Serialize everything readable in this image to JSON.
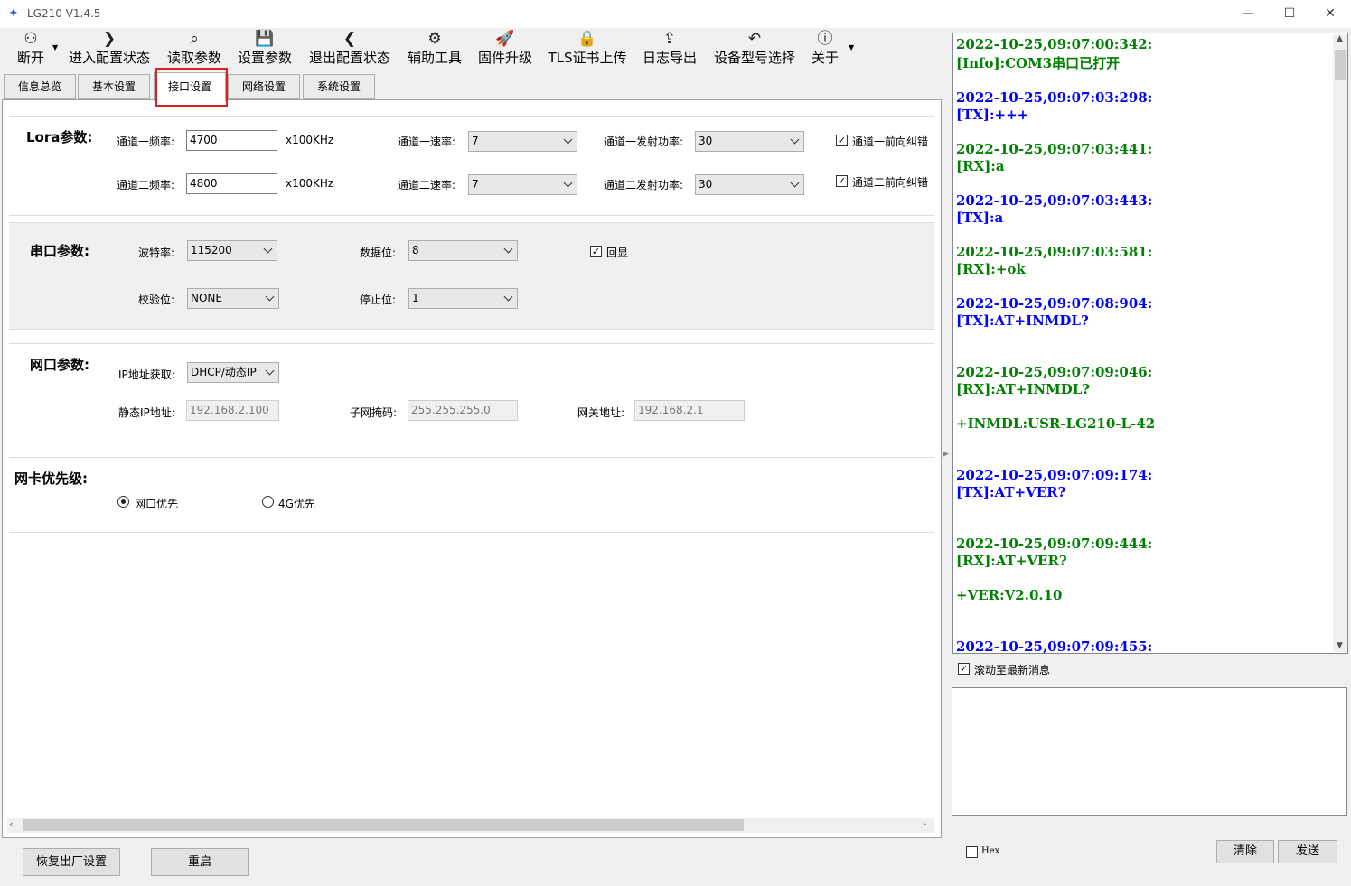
{
  "app": {
    "title": "LG210 V1.4.5"
  },
  "window": {
    "minimize": "—",
    "maximize": "☐",
    "close": "✕"
  },
  "toolbar": {
    "items": [
      {
        "icon": "⚇",
        "label": "断开"
      },
      {
        "icon": "❯",
        "label": "进入配置状态"
      },
      {
        "icon": "⌕",
        "label": "读取参数"
      },
      {
        "icon": "💾",
        "label": "设置参数"
      },
      {
        "icon": "❮",
        "label": "退出配置状态"
      },
      {
        "icon": "⚙",
        "label": "辅助工具"
      },
      {
        "icon": "🚀",
        "label": "固件升级"
      },
      {
        "icon": "🔒",
        "label": "TLS证书上传"
      },
      {
        "icon": "⇪",
        "label": "日志导出"
      },
      {
        "icon": "↶",
        "label": "设备型号选择"
      },
      {
        "icon": "ⓘ",
        "label": "关于"
      }
    ]
  },
  "tabs": [
    "信息总览",
    "基本设置",
    "接口设置",
    "网络设置",
    "系统设置"
  ],
  "active_tab": "接口设置",
  "lora": {
    "title": "Lora参数:",
    "ch1_freq_label": "通道一频率:",
    "ch1_freq": "4700",
    "unit": "x100KHz",
    "ch2_freq_label": "通道二频率:",
    "ch2_freq": "4800",
    "ch1_rate_label": "通道一速率:",
    "ch1_rate": "7",
    "ch2_rate_label": "通道二速率:",
    "ch2_rate": "7",
    "ch1_power_label": "通道一发射功率:",
    "ch1_power": "30",
    "ch2_power_label": "通道二发射功率:",
    "ch2_power": "30",
    "ch1_fec_label": "通道一前向纠错",
    "ch1_fec": true,
    "ch2_fec_label": "通道二前向纠错",
    "ch2_fec": true
  },
  "serial": {
    "title": "串口参数:",
    "baud_label": "波特率:",
    "baud": "115200",
    "data_bits_label": "数据位:",
    "data_bits": "8",
    "echo_label": "回显",
    "echo": true,
    "parity_label": "校验位:",
    "parity": "NONE",
    "stop_bits_label": "停止位:",
    "stop_bits": "1"
  },
  "net": {
    "title": "网口参数:",
    "ip_mode_label": "IP地址获取:",
    "ip_mode": "DHCP/动态IP",
    "static_ip_label": "静态IP地址:",
    "static_ip": "192.168.2.100",
    "mask_label": "子网掩码:",
    "mask": "255.255.255.0",
    "gateway_label": "网关地址:",
    "gateway": "192.168.2.1"
  },
  "nic": {
    "title": "网卡优先级:",
    "option_eth": "网口优先",
    "option_4g": "4G优先",
    "selected": "网口优先"
  },
  "buttons": {
    "factory_reset": "恢复出厂设置",
    "restart": "重启",
    "clear": "清除",
    "send": "发送"
  },
  "log": {
    "lines": [
      {
        "text": "2022-10-25,09:07:00:342:",
        "color": "#008000"
      },
      {
        "text": "[Info]:COM3串口已打开",
        "color": "#008000"
      },
      {
        "text": "2022-10-25,09:07:03:298:",
        "color": "#0000ff"
      },
      {
        "text": "[TX]:+++",
        "color": "#0000ff"
      },
      {
        "text": "2022-10-25,09:07:03:441:",
        "color": "#008000"
      },
      {
        "text": "[RX]:a",
        "color": "#008000"
      },
      {
        "text": "2022-10-25,09:07:03:443:",
        "color": "#0000ff"
      },
      {
        "text": "[TX]:a",
        "color": "#0000ff"
      },
      {
        "text": "2022-10-25,09:07:03:581:",
        "color": "#008000"
      },
      {
        "text": "[RX]:+ok",
        "color": "#008000"
      },
      {
        "text": "2022-10-25,09:07:08:904:",
        "color": "#0000ff"
      },
      {
        "text": "[TX]:AT+INMDL?",
        "color": "#0000ff"
      },
      {
        "text": "2022-10-25,09:07:09:046:",
        "color": "#008000"
      },
      {
        "text": "[RX]:AT+INMDL?",
        "color": "#008000"
      },
      {
        "text": "+INMDL:USR-LG210-L-42",
        "color": "#008000"
      },
      {
        "text": "2022-10-25,09:07:09:174:",
        "color": "#0000ff"
      },
      {
        "text": "[TX]:AT+VER?",
        "color": "#0000ff"
      },
      {
        "text": "2022-10-25,09:07:09:444:",
        "color": "#008000"
      },
      {
        "text": "[RX]:AT+VER?",
        "color": "#008000"
      },
      {
        "text": "+VER:V2.0.10",
        "color": "#008000"
      },
      {
        "text": "2022-10-25,09:07:09:455:",
        "color": "#0000ff"
      }
    ]
  },
  "autoscroll": {
    "label": "滚动至最新消息",
    "checked": true
  },
  "hex": {
    "label": "Hex",
    "checked": false
  }
}
